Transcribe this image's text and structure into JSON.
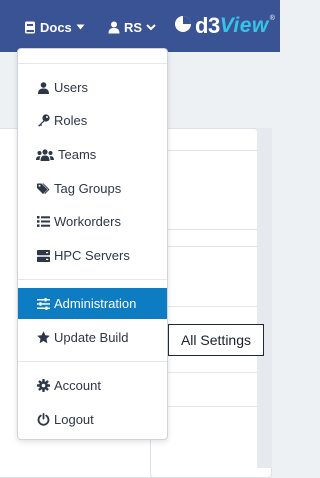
{
  "navbar": {
    "docs_label": "Docs",
    "user_label": "RS",
    "logo": {
      "prefix": "d3",
      "suffix": "View",
      "reg": "®"
    },
    "colors": {
      "background": "#3a5395",
      "logo_accent": "#36c3e6"
    }
  },
  "menu": {
    "items": [
      {
        "label": "Users",
        "icon": "user-icon"
      },
      {
        "label": "Roles",
        "icon": "key-icon"
      },
      {
        "label": "Teams",
        "icon": "users-icon"
      },
      {
        "label": "Tag Groups",
        "icon": "tags-icon"
      },
      {
        "label": "Workorders",
        "icon": "list-icon"
      },
      {
        "label": "HPC Servers",
        "icon": "server-icon"
      },
      {
        "label": "Administration",
        "icon": "sliders-icon",
        "active": true
      },
      {
        "label": "Update Build",
        "icon": "star-icon"
      },
      {
        "label": "Account",
        "icon": "gear-icon"
      },
      {
        "label": "Logout",
        "icon": "power-icon"
      }
    ],
    "active_color": "#0d7cc2"
  },
  "tooltip": {
    "text": "All Settings"
  }
}
